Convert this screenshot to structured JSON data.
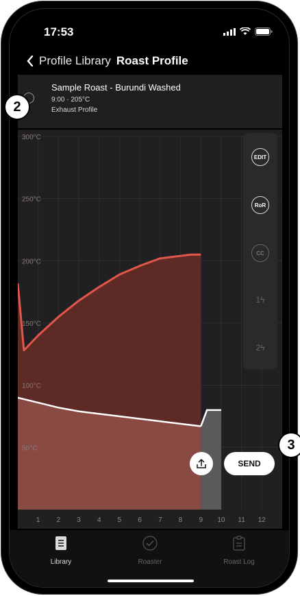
{
  "status": {
    "time": "17:53"
  },
  "nav": {
    "back_label": "Profile Library",
    "title": "Roast Profile"
  },
  "profile": {
    "name": "Sample Roast - Burundi Washed",
    "meta": "9:00 · 205°C",
    "type": "Exhaust Profile"
  },
  "tools": {
    "edit": "EDIT",
    "ror": "RoR",
    "cc": "CC",
    "p1": "1",
    "p2": "2"
  },
  "actions": {
    "send_label": "SEND"
  },
  "tabs": [
    {
      "label": "Library",
      "icon": "library-icon"
    },
    {
      "label": "Roaster",
      "icon": "roaster-icon"
    },
    {
      "label": "Roast Log",
      "icon": "roast-log-icon"
    }
  ],
  "callouts": {
    "a": "2",
    "b": "3"
  },
  "colors": {
    "profile": "#e2574c",
    "fan": "#ffffff",
    "accent_fill": "#6a2f28"
  },
  "chart_data": {
    "type": "area",
    "x": [
      0,
      0.2,
      1,
      2,
      3,
      4,
      5,
      6,
      7,
      8,
      8.5,
      9
    ],
    "xticks": [
      "1",
      "2",
      "3",
      "4",
      "5",
      "6",
      "7",
      "8",
      "9",
      "10",
      "11",
      "12"
    ],
    "xlim": [
      0,
      12
    ],
    "ylim": [
      0,
      300
    ],
    "yticks": [
      "50°C",
      "100°C",
      "150°C",
      "200°C",
      "250°C",
      "300°C"
    ],
    "series": [
      {
        "x": [
          0,
          0.3,
          1,
          2,
          3,
          4,
          5,
          6,
          7,
          8,
          8.5,
          9
        ],
        "values": [
          182,
          128,
          140,
          155,
          168,
          179,
          189,
          196,
          202,
          204,
          205,
          205
        ]
      },
      {
        "x": [
          0,
          1,
          2,
          3,
          4,
          5,
          6,
          7,
          8,
          9
        ],
        "values": [
          90,
          86,
          82,
          79,
          77,
          75,
          73,
          71,
          69,
          67
        ]
      },
      {
        "x": [
          9,
          9.3,
          10
        ],
        "values": [
          67,
          80,
          80
        ]
      }
    ]
  }
}
